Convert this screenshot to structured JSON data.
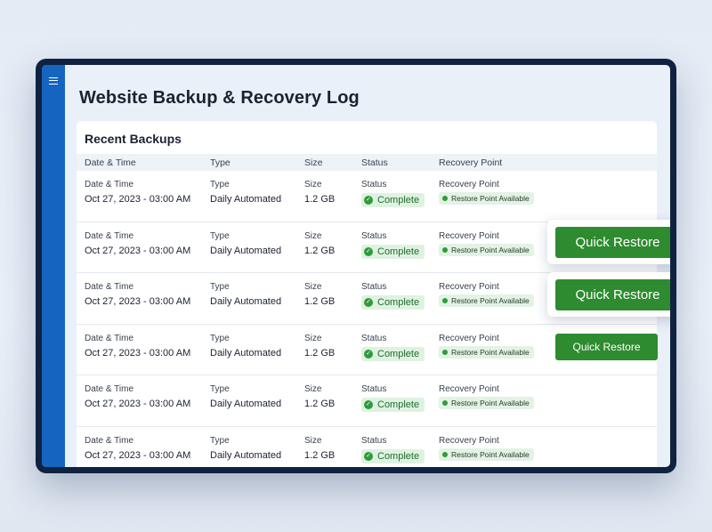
{
  "page_title": "Website Backup & Recovery Log",
  "card_title": "Recent Backups",
  "columns": [
    "Date & Time",
    "Type",
    "Size",
    "Status",
    "Recovery Point"
  ],
  "rows": [
    {
      "date_label": "Date & Time",
      "date": "Oct 27, 2023 - 03:00 AM",
      "type_label": "Type",
      "type": "Daily Automated",
      "size_label": "Size",
      "size": "1.2 GB",
      "status_label": "Status",
      "status": "Complete",
      "rp_label": "Recovery Point",
      "rp": "Restore Point Available"
    },
    {
      "date_label": "Date & Time",
      "date": "Oct 27, 2023 - 03:00 AM",
      "type_label": "Type",
      "type": "Daily Automated",
      "size_label": "Size",
      "size": "1.2 GB",
      "status_label": "Status",
      "status": "Complete",
      "rp_label": "Recovery Point",
      "rp": "Restore Point Available"
    },
    {
      "date_label": "Date & Time",
      "date": "Oct 27, 2023 - 03:00 AM",
      "type_label": "Type",
      "type": "Daily Automated",
      "size_label": "Size",
      "size": "1.2 GB",
      "status_label": "Status",
      "status": "Complete",
      "rp_label": "Recovery Point",
      "rp": "Restore Point Available"
    },
    {
      "date_label": "Date & Time",
      "date": "Oct 27, 2023 - 03:00 AM",
      "type_label": "Type",
      "type": "Daily Automated",
      "size_label": "Size",
      "size": "1.2 GB",
      "status_label": "Status",
      "status": "Complete",
      "rp_label": "Recovery Point",
      "rp": "Restore Point Available"
    },
    {
      "date_label": "Date & Time",
      "date": "Oct 27, 2023 - 03:00 AM",
      "type_label": "Type",
      "type": "Daily Automated",
      "size_label": "Size",
      "size": "1.2 GB",
      "status_label": "Status",
      "status": "Complete",
      "rp_label": "Recovery Point",
      "rp": "Restore Point Available"
    },
    {
      "date_label": "Date & Time",
      "date": "Oct 27, 2023 - 03:00 AM",
      "type_label": "Type",
      "type": "Daily Automated",
      "size_label": "Size",
      "size": "1.2 GB",
      "status_label": "Status",
      "status": "Complete",
      "rp_label": "Recovery Point",
      "rp": "Restore Point Available"
    }
  ],
  "restore_buttons": [
    "Quick Restore",
    "Quick Restore",
    "Quick Restore"
  ],
  "icons": {
    "menu": "hamburger-menu-icon",
    "status": "check-circle-icon",
    "recovery": "green-dot-icon"
  },
  "colors": {
    "sidebar": "#1565c0",
    "frame": "#0f2240",
    "button": "#2e8b2f",
    "status_pill": "#dff2e1"
  }
}
